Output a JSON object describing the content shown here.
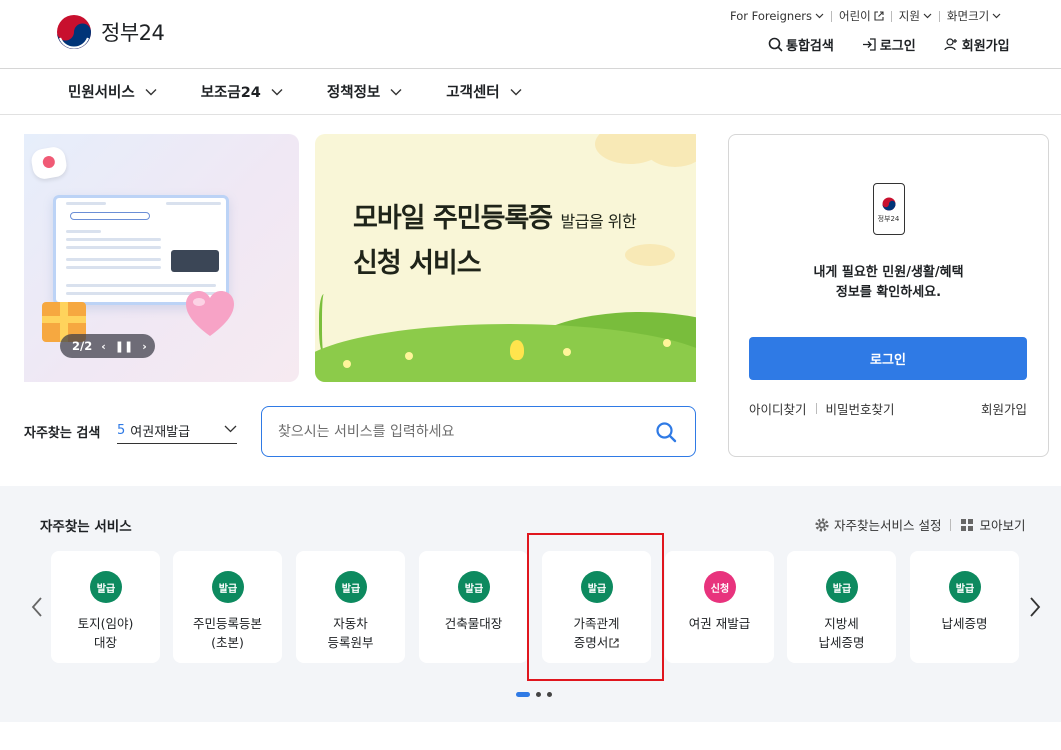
{
  "header": {
    "logo_text": "정부24",
    "util": {
      "foreigners": "For Foreigners",
      "kids": "어린이",
      "support": "지원",
      "screen_size": "화면크기"
    },
    "member": {
      "search": "통합검색",
      "login": "로그인",
      "join": "회원가입"
    }
  },
  "gnb": {
    "items": [
      "민원서비스",
      "보조금24",
      "정책정보",
      "고객센터"
    ]
  },
  "banners": {
    "pager_text": "2/2",
    "promo_title_line1": "모바일 주민등록증",
    "promo_title_small": "발급을 위한",
    "promo_title_line2": "신청 서비스"
  },
  "login_box": {
    "phone_label": "정부24",
    "message_line1": "내게 필요한 민원/생활/혜택",
    "message_line2": "정보를 확인하세요.",
    "login_button": "로그인",
    "find_id": "아이디찾기",
    "find_pw": "비밀번호찾기",
    "join": "회원가입"
  },
  "search": {
    "fav_label": "자주찾는 검색",
    "fav_rank": "5",
    "fav_value": "여권재발급",
    "placeholder": "찾으시는 서비스를 입력하세요"
  },
  "services": {
    "title": "자주찾는 서비스",
    "settings": "자주찾는서비스 설정",
    "view_all": "모아보기",
    "cards": [
      {
        "badge": "발급",
        "type": "issue",
        "line1": "토지(임야)",
        "line2": "대장"
      },
      {
        "badge": "발급",
        "type": "issue",
        "line1": "주민등록등본",
        "line2": "(초본)"
      },
      {
        "badge": "발급",
        "type": "issue",
        "line1": "자동차",
        "line2": "등록원부"
      },
      {
        "badge": "발급",
        "type": "issue",
        "line1": "건축물대장",
        "line2": ""
      },
      {
        "badge": "발급",
        "type": "issue",
        "line1": "가족관계",
        "line2": "증명서"
      },
      {
        "badge": "신청",
        "type": "apply",
        "line1": "여권 재발급",
        "line2": ""
      },
      {
        "badge": "발급",
        "type": "issue",
        "line1": "지방세",
        "line2": "납세증명"
      },
      {
        "badge": "발급",
        "type": "issue",
        "line1": "납세증명",
        "line2": ""
      }
    ]
  },
  "colors": {
    "primary": "#2f7ae5",
    "issue_badge": "#0d8a5f",
    "apply_badge": "#e8337d",
    "highlight": "#e0161e"
  }
}
